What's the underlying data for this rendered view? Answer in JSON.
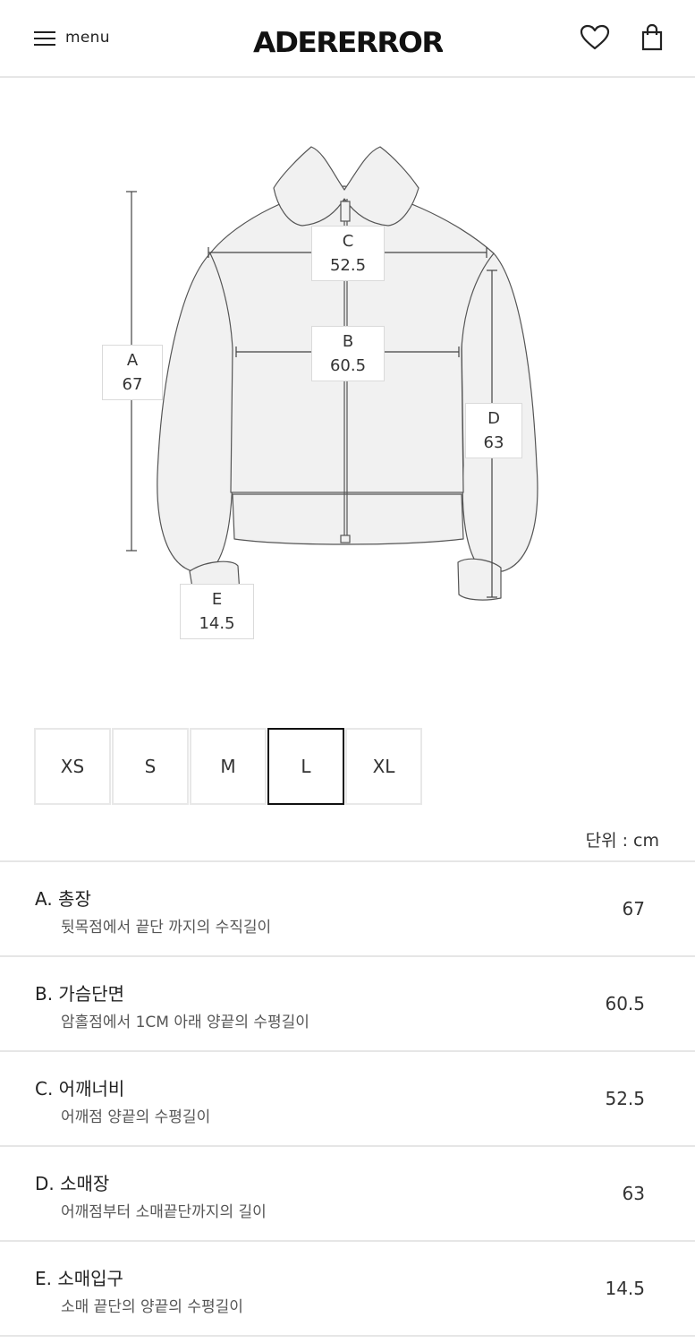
{
  "header": {
    "menu_label": "menu",
    "logo": "ADERERROR"
  },
  "diagram": {
    "labels": {
      "A": {
        "letter": "A",
        "value": "67"
      },
      "B": {
        "letter": "B",
        "value": "60.5"
      },
      "C": {
        "letter": "C",
        "value": "52.5"
      },
      "D": {
        "letter": "D",
        "value": "63"
      },
      "E": {
        "letter": "E",
        "value": "14.5"
      }
    }
  },
  "sizes": {
    "options": [
      "XS",
      "S",
      "M",
      "L",
      "XL"
    ],
    "selected": "L"
  },
  "unit_label": "단위 : cm",
  "measurements": [
    {
      "title": "A.  총장",
      "description": "뒷목점에서 끝단 까지의 수직길이",
      "value": "67"
    },
    {
      "title": "B.  가슴단면",
      "description": "암홀점에서 1CM 아래 양끝의 수평길이",
      "value": "60.5"
    },
    {
      "title": "C.  어깨너비",
      "description": "어깨점 양끝의 수평길이",
      "value": "52.5"
    },
    {
      "title": "D.  소매장",
      "description": "어깨점부터 소매끝단까지의 길이",
      "value": "63"
    },
    {
      "title": "E.  소매입구",
      "description": "소매 끝단의 양끝의 수평길이",
      "value": "14.5"
    }
  ]
}
